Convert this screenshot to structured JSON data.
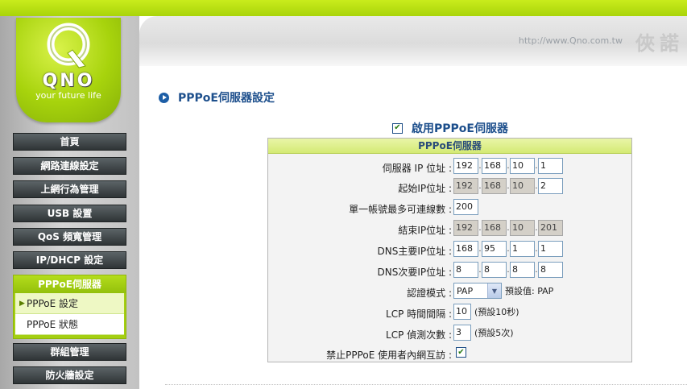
{
  "header": {
    "url": "http://www.Qno.com.tw",
    "brand_cn": "俠諾"
  },
  "logo": {
    "word": "QNO",
    "tagline": "your future life"
  },
  "sidebar": {
    "items": [
      {
        "label": "首頁"
      },
      {
        "label": "網路連線設定"
      },
      {
        "label": "上網行為管理"
      },
      {
        "label": "USB 設置"
      },
      {
        "label": "QoS 頻寬管理"
      },
      {
        "label": "IP/DHCP 設定"
      }
    ],
    "group": {
      "title": "PPPoE伺服器",
      "subitems": [
        {
          "label": "PPPoE 設定",
          "active": true
        },
        {
          "label": "PPPoE 狀態",
          "active": false
        }
      ]
    },
    "items_after": [
      {
        "label": "群組管理"
      },
      {
        "label": "防火牆設定"
      }
    ]
  },
  "page": {
    "title": "PPPoE伺服器設定",
    "enable_label": "啟用PPPoE伺服器",
    "enable_checked": true
  },
  "form": {
    "header": "PPPoE伺服器",
    "server_ip": {
      "label": "伺服器 IP 位址 :",
      "octets": [
        "192",
        "168",
        "10",
        "1"
      ]
    },
    "start_ip": {
      "label": "起始IP位址 :",
      "octets": [
        "192",
        "168",
        "10",
        "2"
      ]
    },
    "max_sessions": {
      "label": "單一帳號最多可連線數 :",
      "value": "200"
    },
    "end_ip": {
      "label": "結束IP位址 :",
      "octets": [
        "192",
        "168",
        "10",
        "201"
      ]
    },
    "dns_primary": {
      "label": "DNS主要IP位址 :",
      "octets": [
        "168",
        "95",
        "1",
        "1"
      ]
    },
    "dns_secondary": {
      "label": "DNS次要IP位址 :",
      "octets": [
        "8",
        "8",
        "8",
        "8"
      ]
    },
    "auth_mode": {
      "label": "認證模式 :",
      "value": "PAP",
      "hint": "預設值: PAP"
    },
    "lcp_interval": {
      "label": "LCP 時間間隔 :",
      "value": "10",
      "hint": "(預設10秒)"
    },
    "lcp_failures": {
      "label": "LCP 偵測次數 :",
      "value": "3",
      "hint": "(預設5次)"
    },
    "block_intercom": {
      "label": "禁止PPPoE 使用者內網互訪 :",
      "checked": true
    }
  },
  "colors": {
    "accent_lime": "#a4cf12",
    "title_blue": "#1d4f8c",
    "nav_dark": "#2f3436"
  }
}
